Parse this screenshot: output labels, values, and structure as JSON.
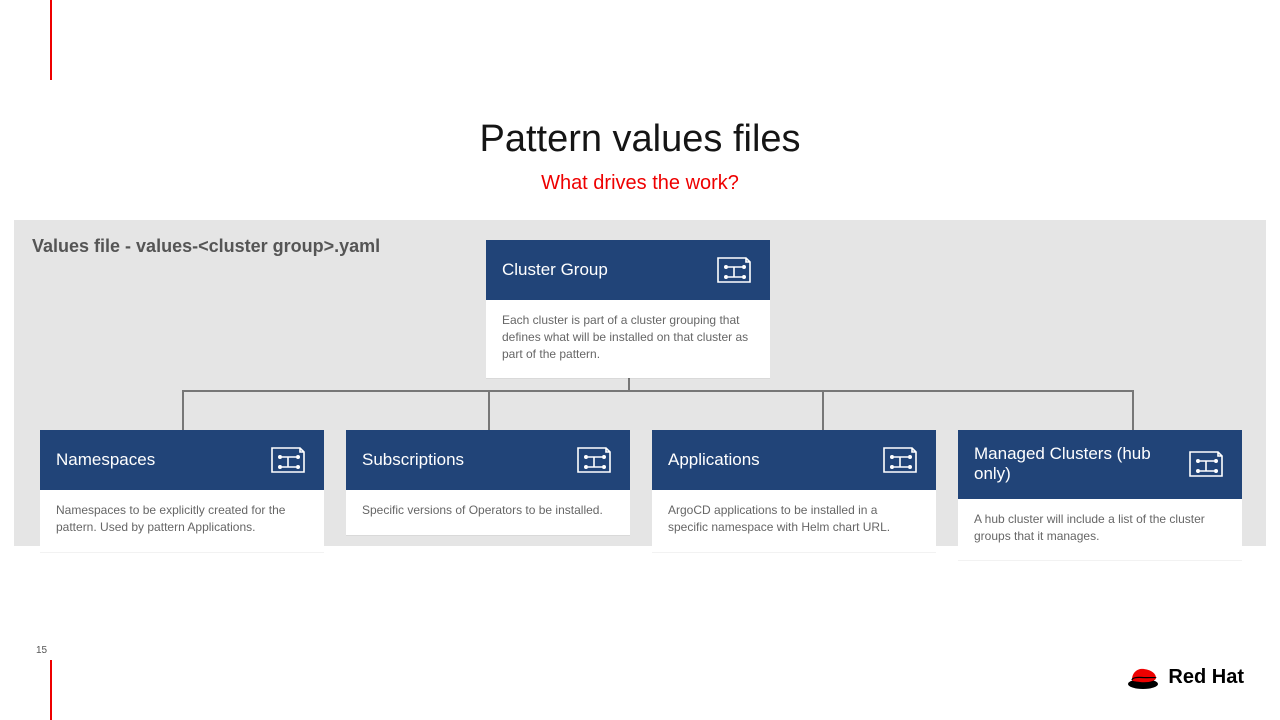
{
  "title": "Pattern values files",
  "subtitle": "What drives the work?",
  "diagram_label": "Values file - values-<cluster group>.yaml",
  "root": {
    "title": "Cluster Group",
    "body": "Each cluster is part of a cluster grouping that defines what will be installed on that cluster as part of the pattern."
  },
  "children": [
    {
      "title": "Namespaces",
      "body": "Namespaces to be explicitly created for the pattern. Used by pattern Applications."
    },
    {
      "title": "Subscriptions",
      "body": "Specific versions of Operators to be installed."
    },
    {
      "title": "Applications",
      "body": "ArgoCD applications to be installed in a specific namespace with Helm chart URL."
    },
    {
      "title": "Managed Clusters (hub only)",
      "body": "A hub cluster will include a list of the cluster groups that it manages."
    }
  ],
  "page_number": "15",
  "brand": "Red Hat"
}
